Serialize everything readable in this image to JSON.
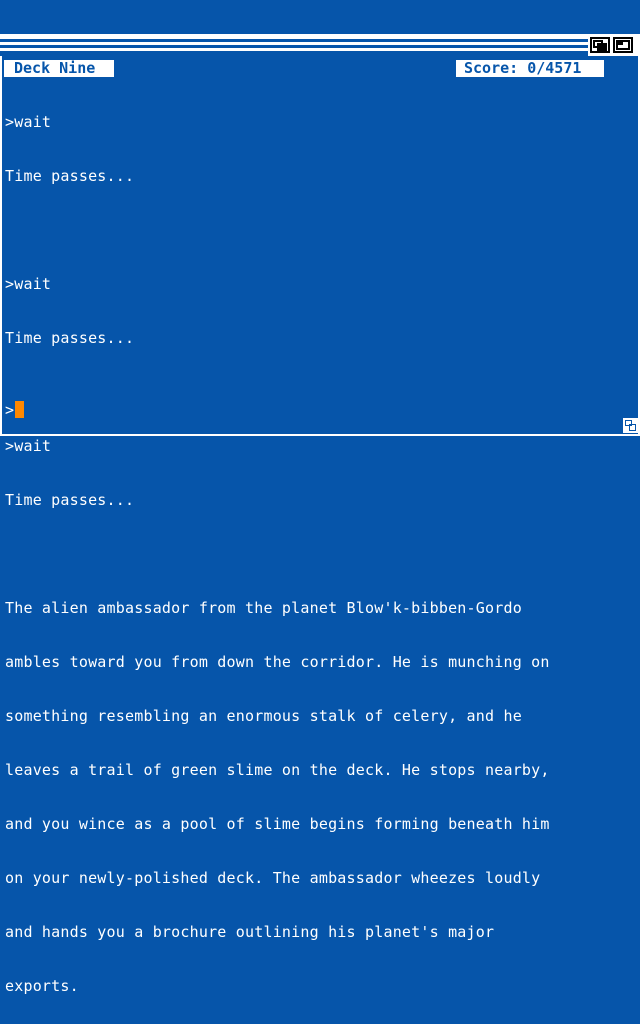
{
  "status": {
    "location": "Deck Nine",
    "score": "Score: 0/4571"
  },
  "transcript": [
    ">wait",
    "Time passes...",
    "",
    ">wait",
    "Time passes...",
    "",
    ">wait",
    "Time passes...",
    "",
    "The alien ambassador from the planet Blow'k-bibben-Gordo",
    "ambles toward you from down the corridor. He is munching on",
    "something resembling an enormous stalk of celery, and he",
    "leaves a trail of green slime on the deck. He stops nearby,",
    "and you wince as a pool of slime begins forming beneath him",
    "on your newly-polished deck. The ambassador wheezes loudly",
    "and hands you a brochure outlining his planet's major",
    "exports."
  ],
  "prompt": {
    "symbol": ">"
  },
  "colors": {
    "background": "#0655aa",
    "text": "#ffffff",
    "cursor": "#ff8800"
  },
  "icons": [
    "depth-gadget-icon",
    "zoom-gadget-icon",
    "size-gadget-icon"
  ]
}
